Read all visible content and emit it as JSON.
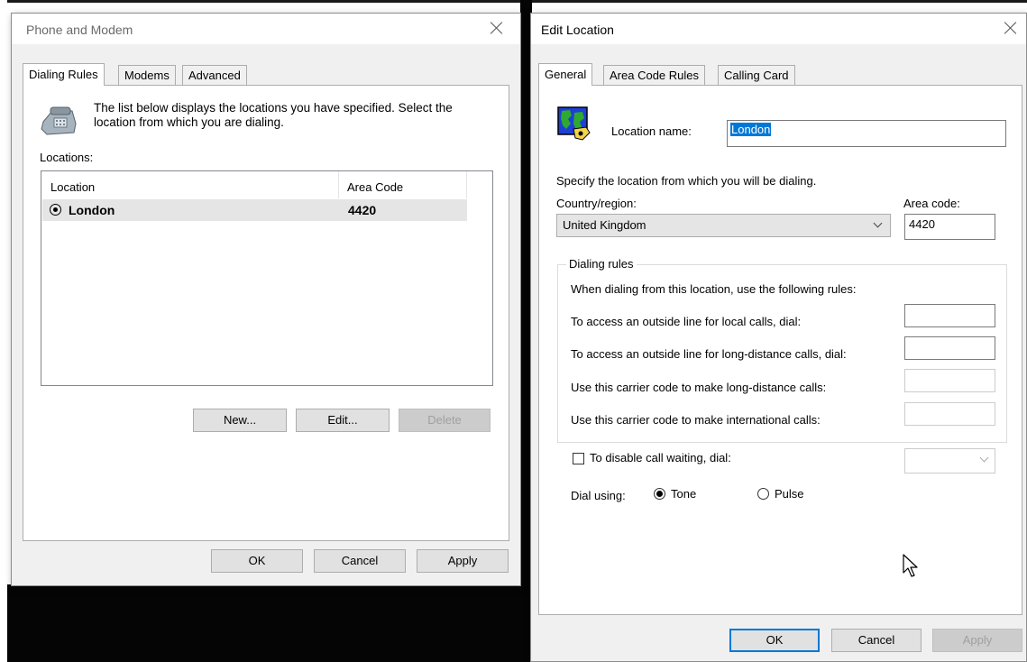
{
  "phone_modem": {
    "title": "Phone and Modem",
    "tabs": [
      "Dialing Rules",
      "Modems",
      "Advanced"
    ],
    "description": "The list below displays the locations you have specified. Select the location from which you are dialing.",
    "locations_label": "Locations:",
    "columns": [
      "Location",
      "Area Code"
    ],
    "rows": [
      {
        "location": "London",
        "area_code": "4420"
      }
    ],
    "buttons": {
      "new": "New...",
      "edit": "Edit...",
      "delete": "Delete"
    },
    "footer": {
      "ok": "OK",
      "cancel": "Cancel",
      "apply": "Apply"
    }
  },
  "edit_location": {
    "title": "Edit Location",
    "tabs": [
      "General",
      "Area Code Rules",
      "Calling Card"
    ],
    "location_name_label": "Location name:",
    "location_name_value": "London",
    "specify_text": "Specify the location from which you will be dialing.",
    "country_label": "Country/region:",
    "country_value": "United Kingdom",
    "area_code_label": "Area code:",
    "area_code_value": "4420",
    "dialing_rules": {
      "group_label": "Dialing rules",
      "intro": "When dialing from this location, use the following rules:",
      "local_line": "To access an outside line for local calls, dial:",
      "long_distance_line": "To access an outside line for long-distance calls, dial:",
      "carrier_long_distance": "Use this carrier code to make long-distance calls:",
      "carrier_international": "Use this carrier code to make international calls:"
    },
    "disable_call_waiting": "To disable call waiting, dial:",
    "dial_using_label": "Dial using:",
    "tone_label": "Tone",
    "pulse_label": "Pulse",
    "footer": {
      "ok": "OK",
      "cancel": "Cancel",
      "apply": "Apply"
    }
  }
}
